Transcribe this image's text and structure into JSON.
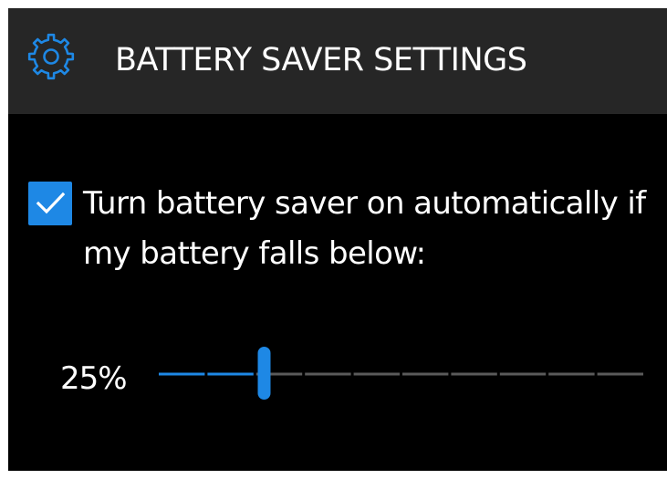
{
  "header": {
    "title": "BATTERY SAVER SETTINGS",
    "icon": "gear-icon"
  },
  "auto_saver": {
    "checked": true,
    "label": "Turn battery saver on automatically if my battery falls below:"
  },
  "threshold": {
    "value_label": "25%",
    "level": 0.25,
    "tick_count": 10
  },
  "colors": {
    "header_bg": "#262626",
    "panel_bg": "#000000",
    "accent": "#1e88e5",
    "track_off": "#5a5a5a",
    "text": "#ffffff"
  }
}
